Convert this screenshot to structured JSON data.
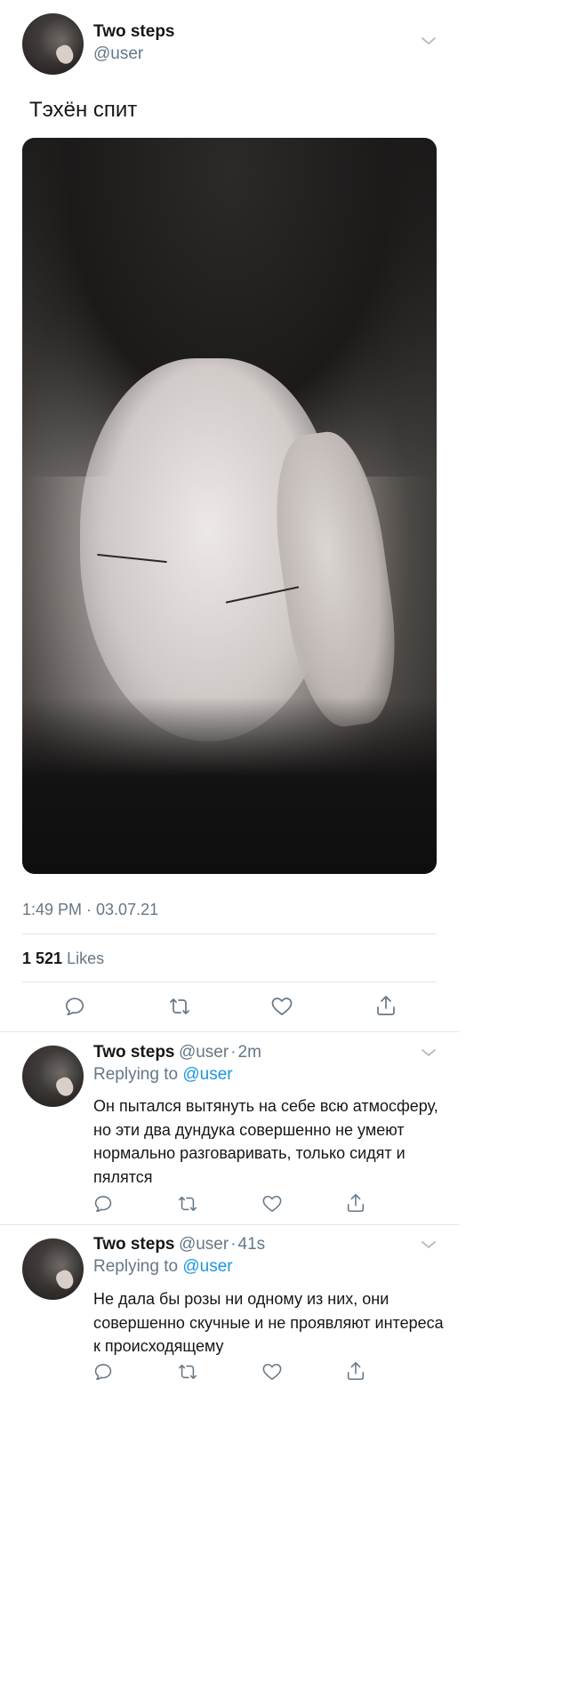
{
  "tweet": {
    "author_name": "Two steps",
    "author_handle": "@user",
    "text": "Тэхён спит",
    "timestamp": "1:49 PM · 03.07.21",
    "likes_count": "1 521",
    "likes_label": "Likes"
  },
  "replies": [
    {
      "author_name": "Two steps",
      "author_handle": "@user",
      "sep": "·",
      "time": "2m",
      "replying_prefix": "Replying to",
      "replying_to": "@user",
      "text": "Он пытался вытянуть на себе всю атмосферу, но эти два дундука совершенно не умеют нормально разговаривать, только сидят и пялятся"
    },
    {
      "author_name": "Two steps",
      "author_handle": "@user",
      "sep": "·",
      "time": "41s",
      "replying_prefix": "Replying to",
      "replying_to": "@user",
      "text": "Не дала бы розы ни одному из них, они совершенно скучные и не проявляют интереса к происходящему"
    }
  ],
  "icons": [
    "chevron-down-icon",
    "reply-icon",
    "retweet-icon",
    "like-icon",
    "share-icon"
  ],
  "colors": {
    "text": "#14171a",
    "secondary": "#657786",
    "link": "#1b95e0",
    "divider": "#e1e8ed"
  }
}
